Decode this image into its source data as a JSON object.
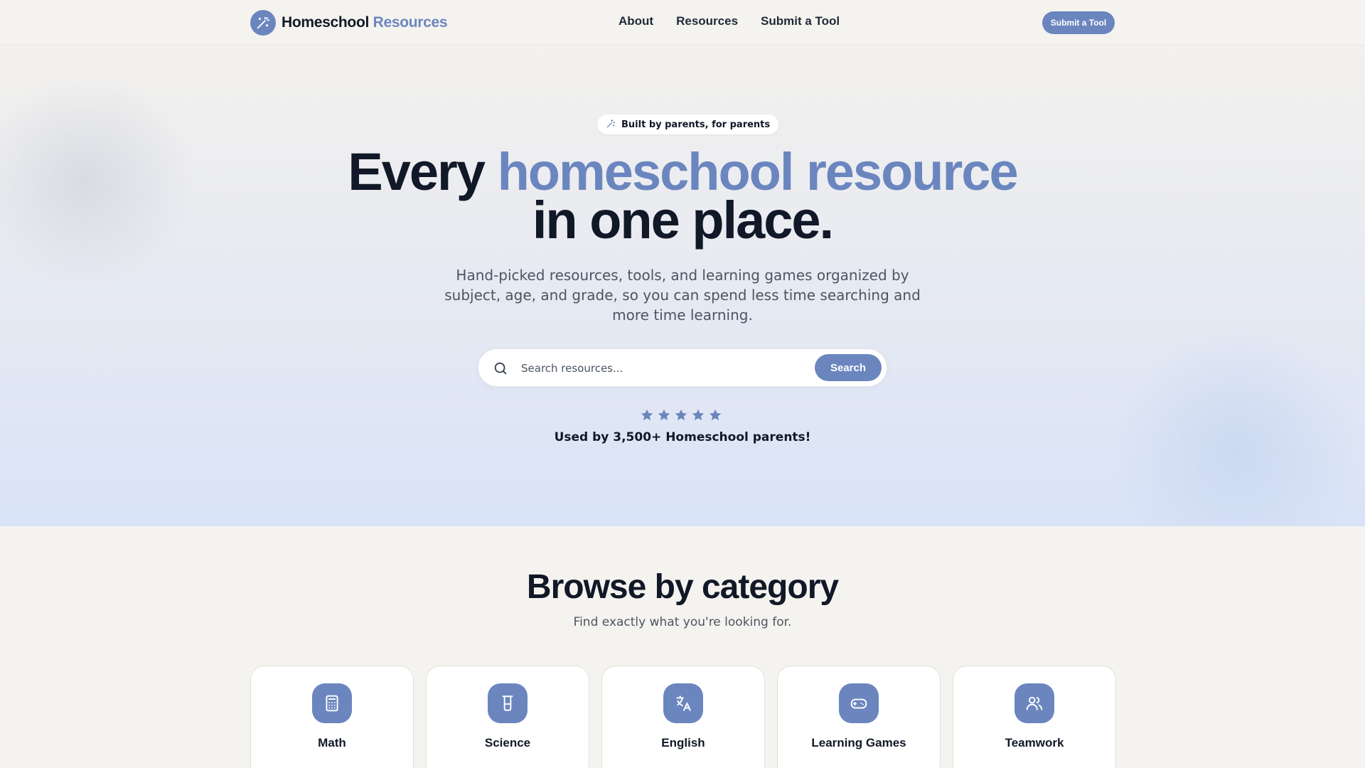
{
  "nav": {
    "brand_primary": "Homeschool",
    "brand_accent": "Resources",
    "links": [
      "About",
      "Resources",
      "Submit a Tool"
    ],
    "cta_label": "Submit a Tool"
  },
  "hero": {
    "badge": "Built by parents, for parents",
    "headline_part1": "Every ",
    "headline_accent": "homeschool resource",
    "headline_part2": "in one place.",
    "subhead": "Hand-picked resources, tools, and learning games organized by subject, age, and grade, so you can spend less time searching and more time learning.",
    "search_placeholder": "Search resources...",
    "search_button": "Search",
    "rating_stars": 5,
    "social_proof": "Used by 3,500+ Homeschool parents!"
  },
  "browse": {
    "title": "Browse by category",
    "subtitle": "Find exactly what you're looking for.",
    "categories": [
      {
        "label": "Math",
        "icon": "calculator-icon"
      },
      {
        "label": "Science",
        "icon": "beaker-icon"
      },
      {
        "label": "English",
        "icon": "translate-icon"
      },
      {
        "label": "Learning Games",
        "icon": "gamepad-icon"
      },
      {
        "label": "Teamwork",
        "icon": "users-icon"
      }
    ]
  },
  "colors": {
    "accent": "#6b86bf",
    "text": "#111827",
    "muted": "#4b5563",
    "background": "#f5f3ef"
  }
}
